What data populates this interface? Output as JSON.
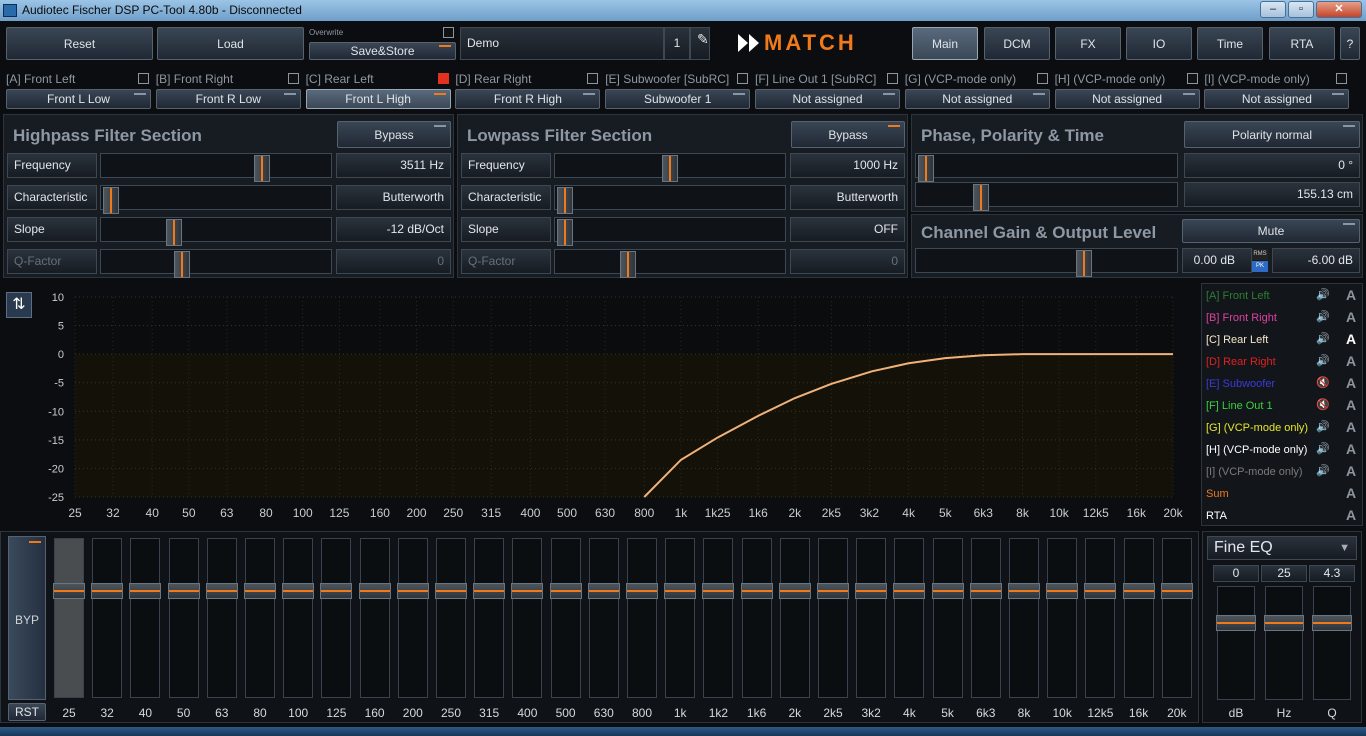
{
  "window": {
    "title": "Audiotec Fischer DSP PC-Tool 4.80b - Disconnected",
    "btn_min": "‒",
    "btn_max": "▫",
    "btn_close": "✕"
  },
  "toolbar": {
    "reset": "Reset",
    "load": "Load",
    "overwrite": "Overwrite",
    "save_store": "Save&Store",
    "preset_name": "Demo",
    "preset_number": "1",
    "logo": "MATCH",
    "tabs": [
      "Main",
      "DCM",
      "FX",
      "IO",
      "Time",
      "RTA",
      "?"
    ]
  },
  "channels": [
    {
      "label": "[A] Front Left",
      "assign": "Front L Low",
      "checked": false
    },
    {
      "label": "[B] Front Right",
      "assign": "Front R Low",
      "checked": false
    },
    {
      "label": "[C] Rear Left",
      "assign": "Front L High",
      "checked": true
    },
    {
      "label": "[D] Rear Right",
      "assign": "Front R High",
      "checked": false
    },
    {
      "label": "[E] Subwoofer [SubRC]",
      "assign": "Subwoofer 1",
      "checked": false
    },
    {
      "label": "[F] Line Out 1 [SubRC]",
      "assign": "Not assigned",
      "checked": false
    },
    {
      "label": "[G] (VCP-mode only)",
      "assign": "Not assigned",
      "checked": false
    },
    {
      "label": "[H] (VCP-mode only)",
      "assign": "Not assigned",
      "checked": false
    },
    {
      "label": "[I] (VCP-mode only)",
      "assign": "Not assigned",
      "checked": false
    }
  ],
  "highpass": {
    "title": "Highpass Filter Section",
    "bypass": "Bypass",
    "rows": [
      {
        "label": "Frequency",
        "value": "3511 Hz",
        "pos": 0.72
      },
      {
        "label": "Characteristic",
        "value": "Butterworth",
        "pos": 0.0
      },
      {
        "label": "Slope",
        "value": "-12 dB/Oct",
        "pos": 0.3
      },
      {
        "label": "Q-Factor",
        "value": "0",
        "pos": 0.34
      }
    ]
  },
  "lowpass": {
    "title": "Lowpass Filter Section",
    "bypass": "Bypass",
    "rows": [
      {
        "label": "Frequency",
        "value": "1000 Hz",
        "pos": 0.5
      },
      {
        "label": "Characteristic",
        "value": "Butterworth",
        "pos": 0.0
      },
      {
        "label": "Slope",
        "value": "OFF",
        "pos": 0.0
      },
      {
        "label": "Q-Factor",
        "value": "0",
        "pos": 0.3
      }
    ]
  },
  "phase": {
    "title": "Phase, Polarity & Time",
    "polarity": "Polarity normal",
    "phase_value": "0 °",
    "phase_pos": 0.0,
    "time_value": "155.13 cm",
    "time_pos": 0.23
  },
  "gain": {
    "title": "Channel Gain & Output Level",
    "mute": "Mute",
    "gain_pos": 0.66,
    "level_db": "0.00 dB",
    "rms": "RMS",
    "pk": "PK",
    "output": "-6.00 dB"
  },
  "graph": {
    "y_ticks": [
      "10",
      "5",
      "0",
      "-5",
      "-10",
      "-15",
      "-20",
      "-25"
    ],
    "x_ticks": [
      "25",
      "32",
      "40",
      "50",
      "63",
      "80",
      "100",
      "125",
      "160",
      "200",
      "250",
      "315",
      "400",
      "500",
      "630",
      "800",
      "1k",
      "1k25",
      "1k6",
      "2k",
      "2k5",
      "3k2",
      "4k",
      "5k",
      "6k3",
      "8k",
      "10k",
      "12k5",
      "16k",
      "20k"
    ],
    "curve_color": "#f0b27a",
    "curve": [
      [
        800,
        -25
      ],
      [
        1000,
        -18.5
      ],
      [
        1250,
        -14.6
      ],
      [
        1600,
        -10.8
      ],
      [
        2000,
        -7.7
      ],
      [
        2500,
        -5.2
      ],
      [
        3200,
        -3.0
      ],
      [
        4000,
        -1.6
      ],
      [
        5000,
        -0.7
      ],
      [
        6300,
        -0.2
      ],
      [
        8000,
        0
      ],
      [
        20000,
        0
      ]
    ]
  },
  "legend": [
    {
      "label": "[A] Front Left",
      "color": "#2e7d32",
      "muted": false
    },
    {
      "label": "[B] Front Right",
      "color": "#e040a0",
      "muted": false
    },
    {
      "label": "[C] Rear Left",
      "color": "#f5e6c8",
      "muted": false
    },
    {
      "label": "[D] Rear Right",
      "color": "#e02020",
      "muted": false
    },
    {
      "label": "[E] Subwoofer",
      "color": "#3b3bd6",
      "muted": true
    },
    {
      "label": "[F] Line Out 1",
      "color": "#3ad13a",
      "muted": true
    },
    {
      "label": "[G] (VCP-mode only)",
      "color": "#e6e62a",
      "muted": false
    },
    {
      "label": "[H] (VCP-mode only)",
      "color": "#ffffff",
      "muted": false
    },
    {
      "label": "[I] (VCP-mode only)",
      "color": "#7a7a7a",
      "muted": false
    },
    {
      "label": "Sum",
      "color": "#f07a1a",
      "muted": false
    },
    {
      "label": "RTA",
      "color": "#ffffff",
      "muted": false
    }
  ],
  "eq": {
    "byp": "BYP",
    "rst": "RST",
    "bands": [
      "25",
      "32",
      "40",
      "50",
      "63",
      "80",
      "100",
      "125",
      "160",
      "200",
      "250",
      "315",
      "400",
      "500",
      "630",
      "800",
      "1k",
      "1k2",
      "1k6",
      "2k",
      "2k5",
      "3k2",
      "4k",
      "5k",
      "6k3",
      "8k",
      "10k",
      "12k5",
      "16k",
      "20k"
    ]
  },
  "fine": {
    "title": "Fine EQ",
    "values": [
      "0",
      "25",
      "4.3"
    ],
    "labels": [
      "dB",
      "Hz",
      "Q"
    ]
  }
}
